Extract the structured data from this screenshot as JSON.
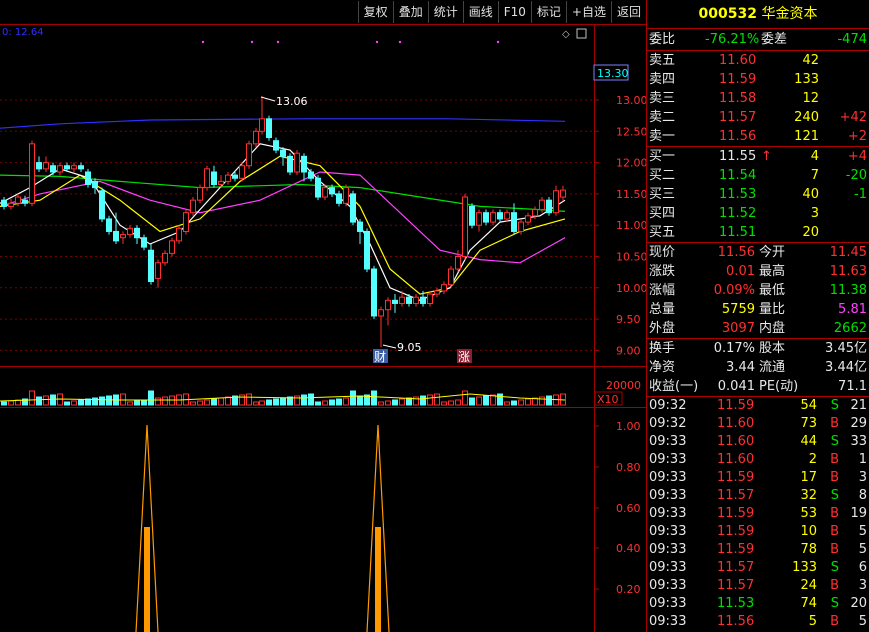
{
  "toolbar": [
    "复权",
    "叠加",
    "统计",
    "画线",
    "F10",
    "标记",
    "+自选",
    "返回"
  ],
  "chart": {
    "ma_readout": "0: 12.64",
    "price_axis": [
      "13.00",
      "12.50",
      "12.00",
      "11.50",
      "11.00",
      "10.50",
      "10.00",
      "9.50",
      "9.00"
    ],
    "current_price_box": "13.30",
    "high_label": "13.06",
    "low_label": "9.05",
    "mark_cai": "财",
    "mark_zhang": "涨",
    "volume_axis": "20000",
    "volume_unit": "X10",
    "indicator_axis": [
      "1.00",
      "0.80",
      "0.60",
      "0.40",
      "0.20"
    ]
  },
  "header": {
    "code": "000532",
    "name": "华金资本"
  },
  "commission": {
    "ratio_label": "委比",
    "ratio_value": "-76.21%",
    "diff_label": "委差",
    "diff_value": "-474"
  },
  "asks": [
    {
      "label": "卖五",
      "price": "11.60",
      "vol": "42",
      "chg": ""
    },
    {
      "label": "卖四",
      "price": "11.59",
      "vol": "133",
      "chg": ""
    },
    {
      "label": "卖三",
      "price": "11.58",
      "vol": "12",
      "chg": ""
    },
    {
      "label": "卖二",
      "price": "11.57",
      "vol": "240",
      "chg": "+42"
    },
    {
      "label": "卖一",
      "price": "11.56",
      "vol": "121",
      "chg": "+2"
    }
  ],
  "bids": [
    {
      "label": "买一",
      "price": "11.55",
      "arrow": "↑",
      "vol": "4",
      "chg": "+4"
    },
    {
      "label": "买二",
      "price": "11.54",
      "arrow": "",
      "vol": "7",
      "chg": "-20"
    },
    {
      "label": "买三",
      "price": "11.53",
      "arrow": "",
      "vol": "40",
      "chg": "-1"
    },
    {
      "label": "买四",
      "price": "11.52",
      "arrow": "",
      "vol": "3",
      "chg": ""
    },
    {
      "label": "买五",
      "price": "11.51",
      "arrow": "",
      "vol": "20",
      "chg": ""
    }
  ],
  "quote": [
    {
      "l1": "现价",
      "v1": "11.56",
      "l2": "今开",
      "v2": "11.45"
    },
    {
      "l1": "涨跌",
      "v1": "0.01",
      "l2": "最高",
      "v2": "11.63"
    },
    {
      "l1": "涨幅",
      "v1": "0.09%",
      "l2": "最低",
      "v2": "11.38"
    },
    {
      "l1": "总量",
      "v1": "5759",
      "l2": "量比",
      "v2": "5.81"
    },
    {
      "l1": "外盘",
      "v1": "3097",
      "l2": "内盘",
      "v2": "2662"
    }
  ],
  "stats": [
    {
      "l1": "换手",
      "v1": "0.17%",
      "l2": "股本",
      "v2": "3.45亿"
    },
    {
      "l1": "净资",
      "v1": "3.44",
      "l2": "流通",
      "v2": "3.44亿"
    },
    {
      "l1": "收益(一)",
      "v1": "0.041",
      "l2": "PE(动)",
      "v2": "71.1"
    }
  ],
  "ticks": [
    {
      "time": "09:32",
      "price": "11.59",
      "vol": "54",
      "side": "S",
      "n": "21"
    },
    {
      "time": "09:32",
      "price": "11.60",
      "vol": "73",
      "side": "B",
      "n": "29"
    },
    {
      "time": "09:33",
      "price": "11.60",
      "vol": "44",
      "side": "S",
      "n": "33"
    },
    {
      "time": "09:33",
      "price": "11.60",
      "vol": "2",
      "side": "B",
      "n": "1"
    },
    {
      "time": "09:33",
      "price": "11.59",
      "vol": "17",
      "side": "B",
      "n": "3"
    },
    {
      "time": "09:33",
      "price": "11.57",
      "vol": "32",
      "side": "S",
      "n": "8"
    },
    {
      "time": "09:33",
      "price": "11.59",
      "vol": "53",
      "side": "B",
      "n": "19"
    },
    {
      "time": "09:33",
      "price": "11.59",
      "vol": "10",
      "side": "B",
      "n": "5"
    },
    {
      "time": "09:33",
      "price": "11.59",
      "vol": "78",
      "side": "B",
      "n": "5"
    },
    {
      "time": "09:33",
      "price": "11.57",
      "vol": "133",
      "side": "S",
      "n": "6"
    },
    {
      "time": "09:33",
      "price": "11.57",
      "vol": "24",
      "side": "B",
      "n": "3"
    },
    {
      "time": "09:33",
      "price": "11.53",
      "vol": "74",
      "side": "S",
      "n": "20"
    },
    {
      "time": "09:33",
      "price": "11.56",
      "vol": "5",
      "side": "B",
      "n": "5"
    }
  ],
  "colors": {
    "up": "#ff3030",
    "down": "#54ffff",
    "ma5": "#ffffff",
    "ma10": "#ffff00",
    "ma20": "#ff40ff",
    "ma30": "#00e000",
    "ma60": "#3030ff",
    "grid": "#7a0000",
    "orange": "#ff9900"
  }
}
